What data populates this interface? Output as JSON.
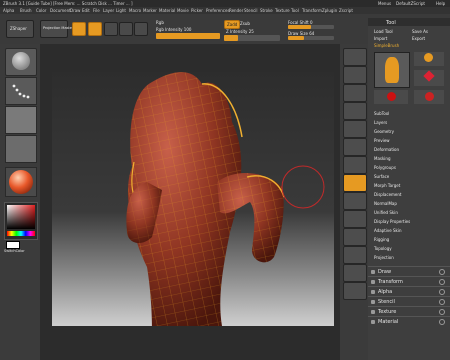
{
  "titlebar": {
    "title": "ZBrush 3.1 [Guide Tube]  [Free Mem: ...  Scratch Disk ...  Timer ... ]",
    "right_items": [
      "Menus",
      "DefaultZScript",
      "Help"
    ]
  },
  "menubar": {
    "items": [
      "Alpha",
      "Brush",
      "Color",
      "Document",
      "Draw",
      "Edit",
      "File",
      "Layer",
      "Light",
      "Macro",
      "Marker",
      "Material",
      "Movie",
      "Picker",
      "Preferences",
      "Render",
      "Stencil",
      "Stroke",
      "Texture",
      "Tool",
      "Transform",
      "Zplugin",
      "Zscript"
    ]
  },
  "toolbar": {
    "zshape_label": "ZShaper",
    "projection_label": "Projection Master",
    "mrgb": "Mrgb",
    "rgb": "Rgb",
    "m": "M",
    "zadd": "Zadd",
    "zsub": "Zsub",
    "zcut": "Zcut",
    "focal_shift": "Focal Shift 0",
    "draw_size": "Draw Size 64",
    "rgb_intensity": "Rgb Intensity 100",
    "z_intensity": "Z Intensity 25",
    "rgb_intensity_fill": 1.0,
    "z_intensity_fill": 0.25,
    "focal_fill": 0.5,
    "draw_fill": 0.35
  },
  "leftshelf": {
    "color_label": "SwitchColor"
  },
  "toolpanel": {
    "header": "Tool",
    "load_tool": "Load Tool",
    "save_as": "Save As",
    "import": "Import",
    "export": "Export",
    "current_tool": "SimpleBrush",
    "thumbs": [
      "SimpleBrush",
      "Polymesh3D",
      "Sphere3D",
      "ZSketch"
    ],
    "items": [
      "SubTool",
      "Layers",
      "Geometry",
      "Preview",
      "Deformation",
      "Masking",
      "Polygroups",
      "Surface",
      "Morph Target",
      "Displacement",
      "NormalMap",
      "Unified Skin",
      "Display Properties",
      "Adaptive Skin",
      "Rigging",
      "Topology",
      "Projection"
    ],
    "subpalettes": [
      "Draw",
      "Transform",
      "Alpha",
      "Stencil",
      "Texture",
      "Material"
    ]
  },
  "colors": {
    "accent": "#e69a22",
    "model": "#9a3b27",
    "wire": "#e8a020"
  }
}
